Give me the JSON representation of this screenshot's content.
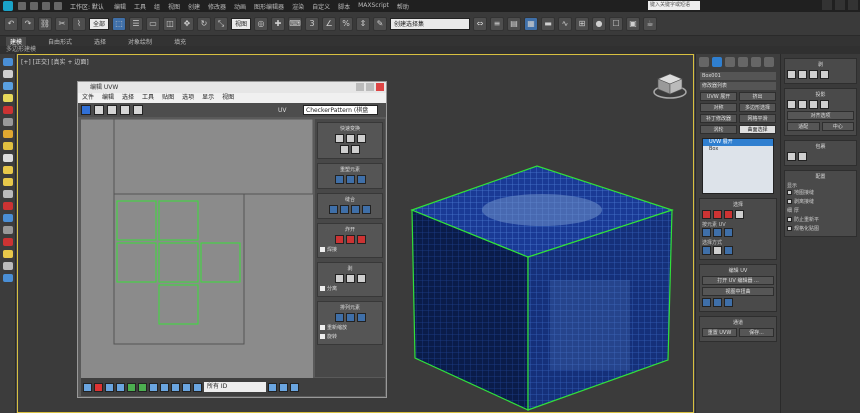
{
  "titlebar": {
    "title": "工作区: 默认",
    "menus": [
      "编辑",
      "工具",
      "组",
      "视图",
      "创建",
      "修改器",
      "动画",
      "图形编辑器",
      "渲染",
      "自定义",
      "脚本",
      "MAXScript",
      "帮助"
    ],
    "search_placeholder": "键入关键字或短语"
  },
  "toolbar": {
    "filter_select": "全部",
    "view_select": "视图",
    "selection_set": "创建选择集"
  },
  "ribbon": {
    "tabs": [
      "建模",
      "自由形式",
      "选择",
      "对象绘制",
      "填充"
    ],
    "subtitle": "多边形建模"
  },
  "viewport": {
    "label": "[+] [正交] [真实 + 边面]"
  },
  "uvw": {
    "title": "编辑 UVW",
    "menus": [
      "文件",
      "编辑",
      "选择",
      "工具",
      "贴图",
      "选项",
      "显示",
      "视图"
    ],
    "uv_label": "UV",
    "checker": "CheckerPattern",
    "checker_select": "(棋盘",
    "panels": {
      "quick": "快速变换",
      "reshape": "重塑元素",
      "stitch": "缝合",
      "explode": "炸开",
      "weld": "焊接",
      "align": "分组",
      "peel": "剥",
      "arrange": "排列元素",
      "split": "分离",
      "sel_mode": "选择方式",
      "align2": "焊接",
      "group": "重新缩放",
      "padding": "旋转"
    },
    "bottom_select": "所有 ID"
  },
  "cmd": {
    "object_name": "Box001",
    "modifier_list": "修改器列表",
    "grid_buttons": [
      "UVW 展开",
      "挤出",
      "对称",
      "多边形选择",
      "补丁修改器",
      "网格平滑",
      "涡轮",
      "曲面选择"
    ],
    "stack": [
      "UVW 展开",
      "Box"
    ],
    "selection_title": "选择",
    "sel_by": "按元素 UV",
    "sel_mode": "选择方式",
    "edit_uv_title": "编辑 UV",
    "open_editor": "打开 UV 编辑器 ...",
    "tweak": "视图中扭曲",
    "channel_title": "通道",
    "reset_uvw": "重置 UVW",
    "save": "保存..."
  },
  "farright": {
    "sections": [
      "剥",
      "投影",
      "包裹",
      "配置"
    ],
    "seam_title": "显示",
    "seam_opts": [
      "地图接缝",
      "剥离接缝"
    ],
    "thin": "细",
    "thick": "厚",
    "prevent": "防止重新平",
    "normalize": "规格化贴图",
    "align_options": [
      "对齐选项",
      "适配",
      "中心"
    ]
  }
}
